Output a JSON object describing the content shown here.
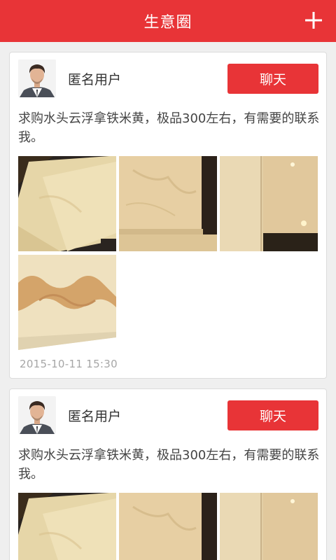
{
  "header": {
    "title": "生意圈",
    "add_icon": "plus-icon"
  },
  "posts": [
    {
      "username": "匿名用户",
      "chat_label": "聊天",
      "content": "求购水头云浮拿铁米黄，极品300左右，有需要的联系我。",
      "timestamp": "2015-10-11  15:30",
      "photos": [
        "tile-photo-1",
        "tile-photo-2",
        "tile-photo-3",
        "tile-photo-4"
      ]
    },
    {
      "username": "匿名用户",
      "chat_label": "聊天",
      "content": "求购水头云浮拿铁米黄，极品300左右，有需要的联系我。",
      "photos": [
        "tile-photo-1",
        "tile-photo-2",
        "tile-photo-3"
      ]
    }
  ],
  "colors": {
    "brand_red": "#e83437",
    "background": "#efefef",
    "timestamp_gray": "#a6a6a6"
  }
}
